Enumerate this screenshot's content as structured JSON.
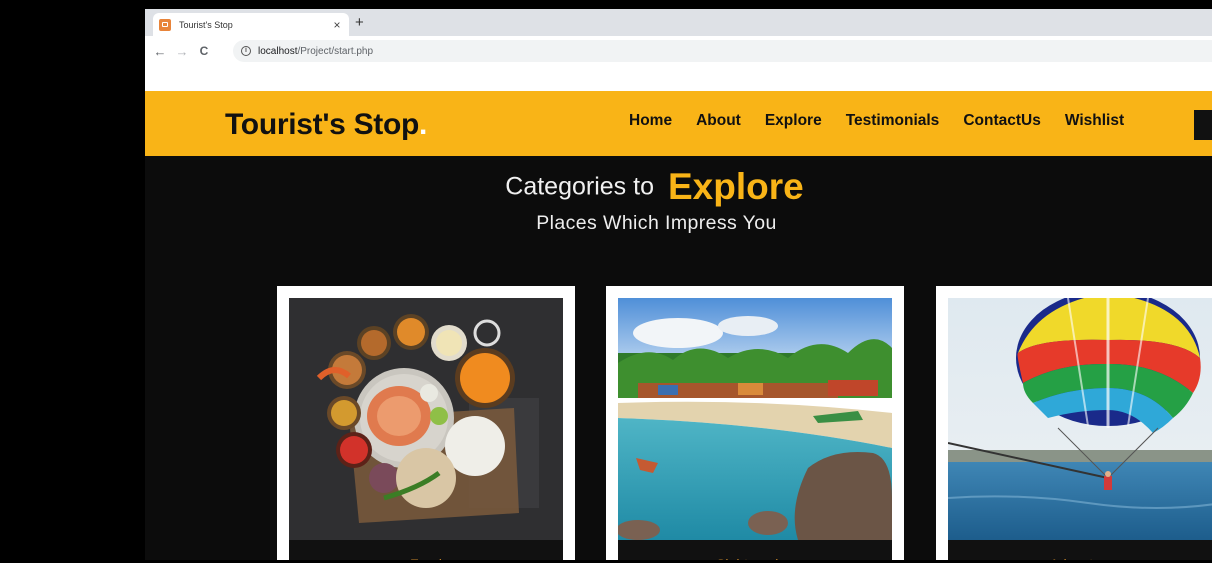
{
  "browser": {
    "tab_title": "Tourist's Stop",
    "tab_close": "×",
    "new_tab": "+",
    "url_host": "localhost",
    "url_path": "/Project/start.php",
    "back": "←",
    "forward": "→",
    "reload": "C",
    "info_icon": "i"
  },
  "header": {
    "logo": "Tourist's Stop",
    "logo_dot": ".",
    "nav": [
      "Home",
      "About",
      "Explore",
      "Testimonials",
      "ContactUs",
      "Wishlist"
    ],
    "brand_color": "#f9b417"
  },
  "section": {
    "title_prefix": "Categories to",
    "title_highlight": "Explore",
    "subtitle": "Places Which Impress You"
  },
  "cards": [
    {
      "label": "Food",
      "image": "food-thali-image"
    },
    {
      "label": "Sight-seeing",
      "image": "beach-image"
    },
    {
      "label": "Adventures",
      "image": "parasailing-image"
    }
  ]
}
